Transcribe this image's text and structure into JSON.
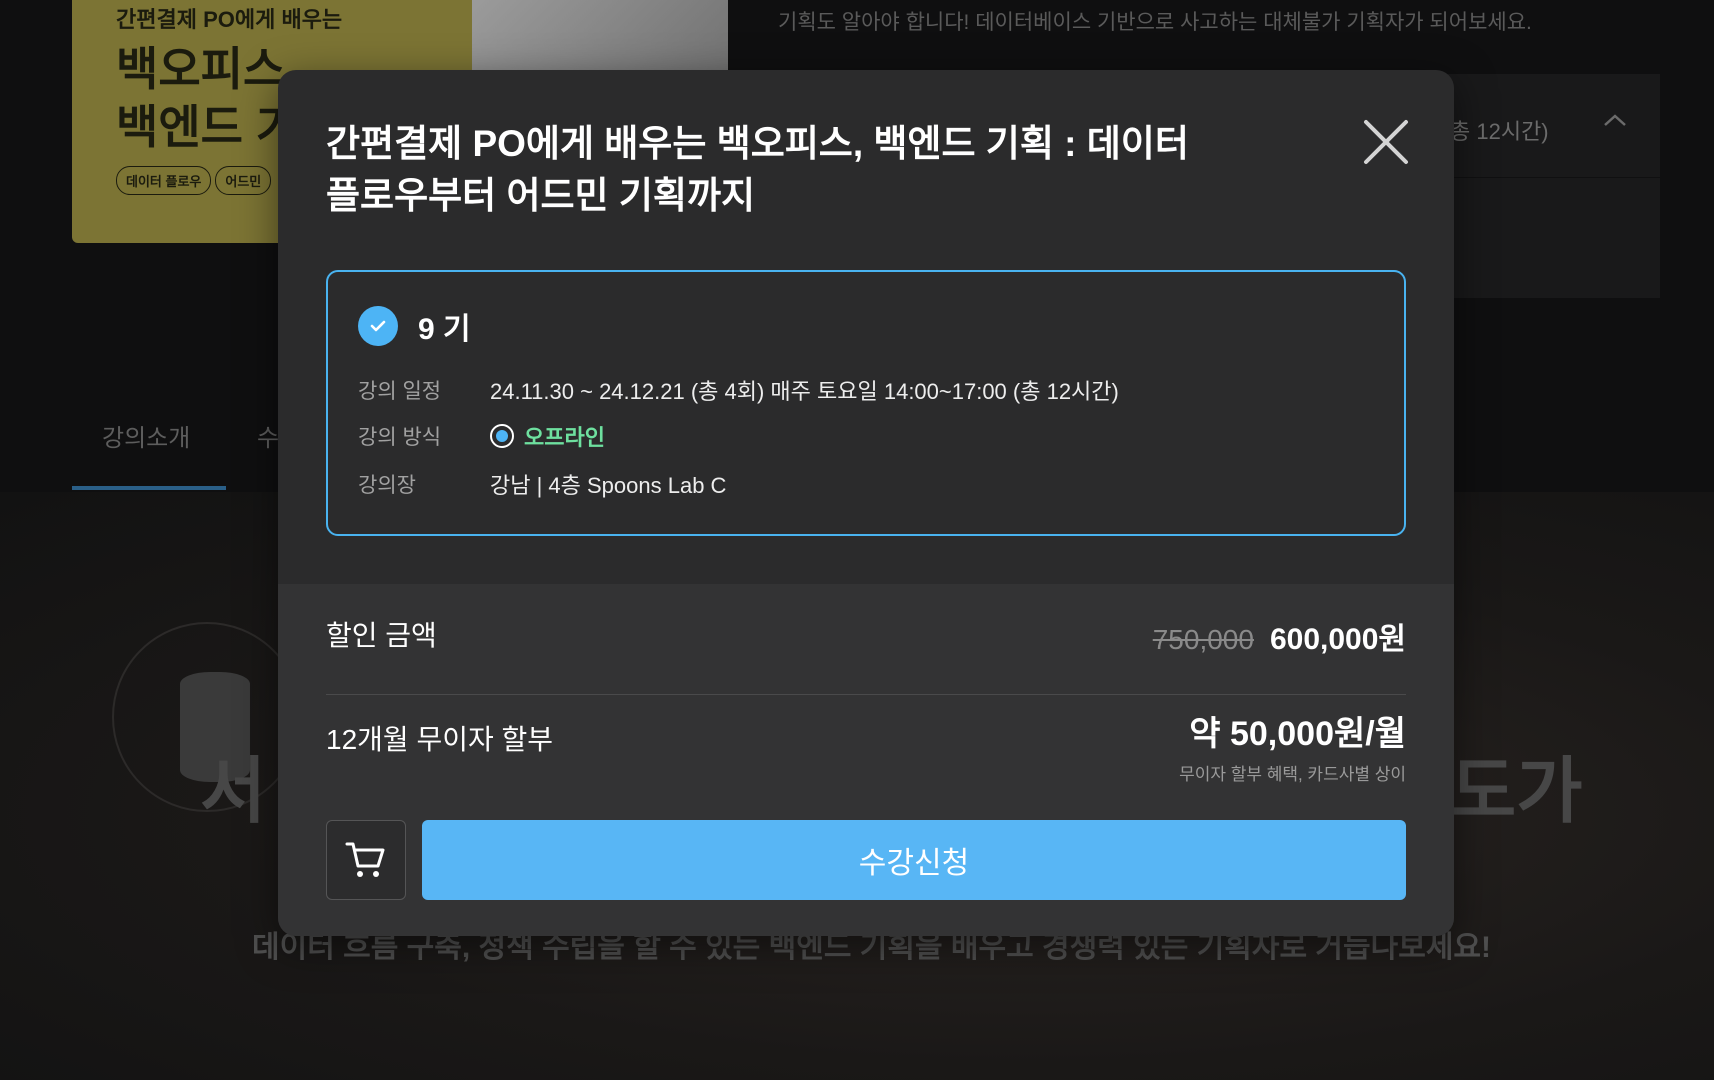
{
  "background": {
    "promo": {
      "subtitle": "간편결제 PO에게 배우는",
      "title_line1": "백오피스",
      "title_line2": "백엔드 기",
      "tags": [
        "데이터 플로우",
        "어드민"
      ]
    },
    "description": "기획도 알아야 합니다! 데이터베이스 기반으로 사고하는 대체불가 기획자가 되어보세요.",
    "accordion_text": "총 12시간)",
    "tabs": [
      "강의소개",
      "수"
    ],
    "hero_big_left": "서",
    "hero_big_right": "도가",
    "hero_line": "데이터 흐름 구축, 정책 수립을 할 수 있는 백엔드 기획을 배우고 경쟁력 있는 기획자로 거듭나보세요!"
  },
  "modal": {
    "title_line1": "간편결제 PO에게 배우는 백오피스, 백엔드 기획 : 데이터",
    "title_line2": "플로우부터 어드민 기획까지",
    "cohort": {
      "name": "9 기",
      "schedule_label": "강의 일정",
      "schedule_value": "24.11.30 ~ 24.12.21 (총 4회) 매주 토요일 14:00~17:00 (총 12시간)",
      "method_label": "강의 방식",
      "method_value": "오프라인",
      "venue_label": "강의장",
      "venue_value": "강남 | 4층 Spoons Lab C"
    },
    "pricing": {
      "discount_label": "할인 금액",
      "original_price": "750,000",
      "final_price": "600,000원",
      "installment_label": "12개월 무이자 할부",
      "installment_amount": "약 50,000원/월",
      "installment_note": "무이자 할부 혜택, 카드사별 상이"
    },
    "enroll_label": "수강신청"
  },
  "colors": {
    "accent": "#58b6f5",
    "method_green": "#6ee09f",
    "modal_bg": "#2b2b2c"
  },
  "icons": [
    "close-icon",
    "check-icon",
    "radio-icon",
    "cart-icon"
  ]
}
